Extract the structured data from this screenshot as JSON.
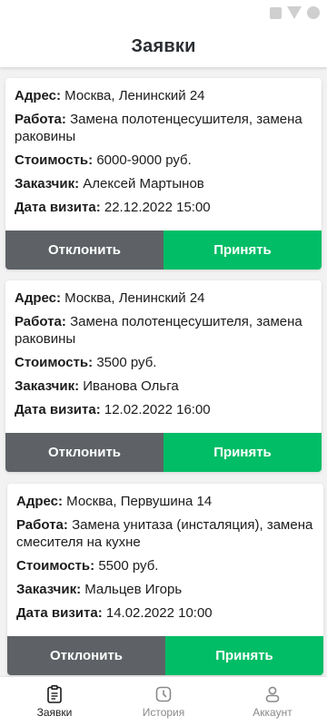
{
  "header": {
    "title": "Заявки"
  },
  "labels": {
    "address": "Адрес:",
    "work": "Работа:",
    "cost": "Стоимость:",
    "customer": "Заказчик:",
    "visit_date": "Дата визита:"
  },
  "buttons": {
    "decline": "Отклонить",
    "accept": "Принять"
  },
  "requests": [
    {
      "address": "Москва, Ленинский 24",
      "work": "Замена полотенцесушителя, замена раковины",
      "cost": "6000-9000 руб.",
      "customer": "Алексей Мартынов",
      "visit_date": "22.12.2022 15:00"
    },
    {
      "address": "Москва, Ленинский 24",
      "work": "Замена полотенцесушителя, замена раковины",
      "cost": "3500 руб.",
      "customer": "Иванова Ольга",
      "visit_date": "12.02.2022 16:00"
    },
    {
      "address": "Москва, Первушина 14",
      "work": "Замена унитаза (инсталяция), замена смесителя на кухне",
      "cost": "5500 руб.",
      "customer": "Мальцев Игорь",
      "visit_date": "14.02.2022 10:00"
    }
  ],
  "bottom_nav": [
    {
      "label": "Заявки",
      "icon": "clipboard-icon",
      "active": true
    },
    {
      "label": "История",
      "icon": "clock-icon",
      "active": false
    },
    {
      "label": "Аккаунт",
      "icon": "user-icon",
      "active": false
    }
  ],
  "colors": {
    "accept": "#00bd66",
    "decline": "#5e6266",
    "background": "#f2f2f2"
  }
}
